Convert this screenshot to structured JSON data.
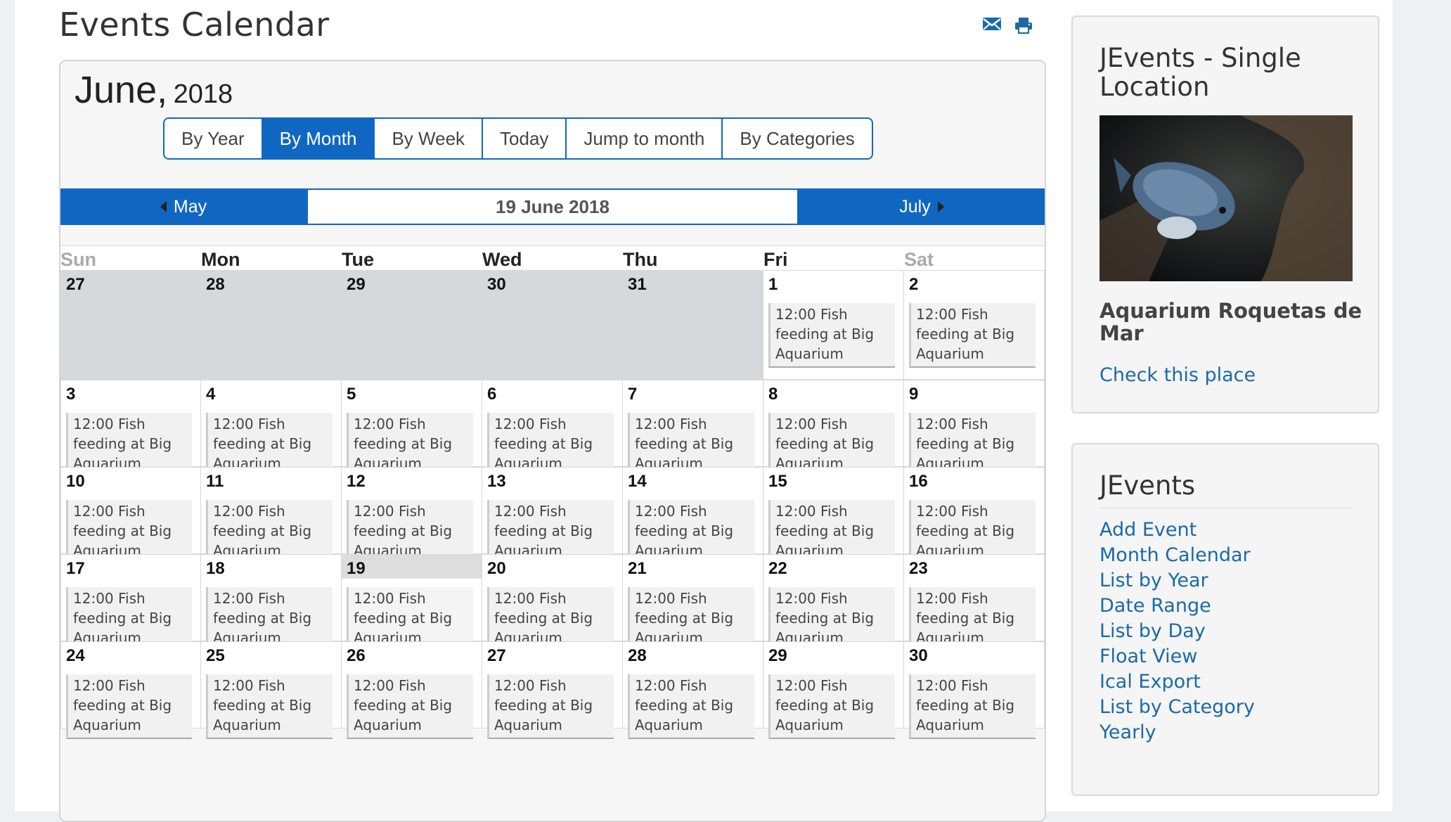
{
  "page": {
    "title": "Events Calendar"
  },
  "calendar": {
    "month": "June,",
    "year": "2018",
    "views": [
      {
        "label": "By Year",
        "active": false
      },
      {
        "label": "By Month",
        "active": true
      },
      {
        "label": "By Week",
        "active": false
      },
      {
        "label": "Today",
        "active": false
      },
      {
        "label": "Jump to month",
        "active": false
      },
      {
        "label": "By Categories",
        "active": false
      }
    ],
    "nav": {
      "prev": "May",
      "current": "19 June 2018",
      "next": "July"
    },
    "weekdays": [
      "Sun",
      "Mon",
      "Tue",
      "Wed",
      "Thu",
      "Fri",
      "Sat"
    ],
    "event_text": [
      "12:00 Fish",
      "feeding at Big",
      "Aquarium"
    ],
    "weeks": [
      [
        {
          "d": "27",
          "other": true,
          "ev": false
        },
        {
          "d": "28",
          "other": true,
          "ev": false
        },
        {
          "d": "29",
          "other": true,
          "ev": false
        },
        {
          "d": "30",
          "other": true,
          "ev": false
        },
        {
          "d": "31",
          "other": true,
          "ev": false
        },
        {
          "d": "1",
          "ev": true
        },
        {
          "d": "2",
          "ev": true
        }
      ],
      [
        {
          "d": "3",
          "ev": true
        },
        {
          "d": "4",
          "ev": true
        },
        {
          "d": "5",
          "ev": true
        },
        {
          "d": "6",
          "ev": true
        },
        {
          "d": "7",
          "ev": true
        },
        {
          "d": "8",
          "ev": true
        },
        {
          "d": "9",
          "ev": true
        }
      ],
      [
        {
          "d": "10",
          "ev": true
        },
        {
          "d": "11",
          "ev": true
        },
        {
          "d": "12",
          "ev": true
        },
        {
          "d": "13",
          "ev": true
        },
        {
          "d": "14",
          "ev": true
        },
        {
          "d": "15",
          "ev": true
        },
        {
          "d": "16",
          "ev": true
        }
      ],
      [
        {
          "d": "17",
          "ev": true
        },
        {
          "d": "18",
          "ev": true
        },
        {
          "d": "19",
          "ev": true,
          "today": true
        },
        {
          "d": "20",
          "ev": true
        },
        {
          "d": "21",
          "ev": true
        },
        {
          "d": "22",
          "ev": true
        },
        {
          "d": "23",
          "ev": true
        }
      ],
      [
        {
          "d": "24",
          "ev": true
        },
        {
          "d": "25",
          "ev": true
        },
        {
          "d": "26",
          "ev": true
        },
        {
          "d": "27",
          "ev": true
        },
        {
          "d": "28",
          "ev": true
        },
        {
          "d": "29",
          "ev": true
        },
        {
          "d": "30",
          "ev": true
        }
      ]
    ]
  },
  "location_module": {
    "title": "JEvents - Single Location",
    "place_name": "Aquarium Roquetas de Mar",
    "link": "Check this place"
  },
  "jevents_module": {
    "title": "JEvents",
    "links": [
      "Add Event",
      "Month Calendar",
      "List by Year",
      "Date Range",
      "List by Day",
      "Float View",
      "Ical Export",
      "List by Category",
      "Yearly"
    ]
  },
  "icons": [
    "email-icon",
    "print-icon",
    "caret-left-icon",
    "caret-right-icon"
  ],
  "colors": {
    "accent": "#1067c2",
    "link": "#1a6aa8",
    "other_month": "#d5d9dc"
  }
}
